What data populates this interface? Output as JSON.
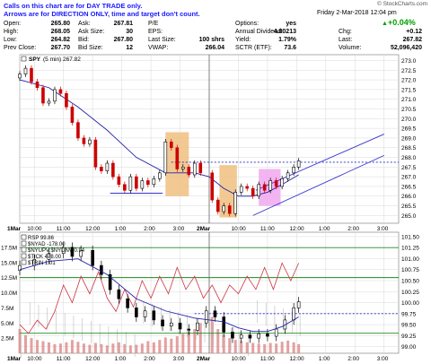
{
  "notes": {
    "line1": "Calls on this chart are for DAY TRADE only.",
    "line2": "Arrows are for DIRECTION ONLY, time and target don't count."
  },
  "header": {
    "date_time": "Friday  2-Mar-2018  12:04 pm",
    "brand": "© StockCharts.com",
    "change_pct": "+0.04%",
    "change_label": "Chg:",
    "change_value": "+0.12",
    "last_label": "Last:",
    "last_value": "267.82",
    "volume_label": "Volume:",
    "volume_value": "52,096,420"
  },
  "quote": {
    "open_label": "Open:",
    "open": "265.80",
    "high_label": "High:",
    "high": "268.05",
    "low_label": "Low:",
    "low": "264.82",
    "prev_label": "Prev Close:",
    "prev": "267.70",
    "ask_label": "Ask:",
    "ask": "267.81",
    "asksize_label": "Ask Size:",
    "asksize": "30",
    "bid_label": "Bid:",
    "bid": "267.80",
    "bidsize_label": "Bid Size:",
    "bidsize": "12",
    "pe_label": "P/E",
    "pe": "",
    "eps_label": "EPS:",
    "eps": "",
    "lastsize_label": "Last Size:",
    "lastsize": "100 shrs",
    "vwap_label": "VWAP:",
    "vwap": "266.04",
    "options_label": "Options:",
    "options": "yes",
    "div_label": "Annual Dividend:",
    "div": "4.80213",
    "yield_label": "Yield:",
    "yield": "1.79%",
    "sctr_label": "SCTR (ETF):",
    "sctr": "73.6"
  },
  "colors": {
    "up": "#000000",
    "down": "#cc0000",
    "ma": "#2222aa",
    "channel": "#3333cc",
    "dotted": "#2222cc",
    "grid": "#d8d8d8",
    "orange_box": "#f0c080",
    "pink_box": "#f0a8f0",
    "green_line": "#1c8c1c",
    "rsp_line": "#cc3344"
  },
  "chart_data": [
    {
      "type": "candlestick",
      "title": "SPY (5 min) 267.82",
      "legend_symbol": "SPY",
      "legend_text": "(5 min) 267.82",
      "y_ticks": [
        "273.0",
        "272.5",
        "272.0",
        "271.5",
        "271.0",
        "270.5",
        "270.0",
        "269.5",
        "269.0",
        "268.5",
        "268.0",
        "267.5",
        "267.0",
        "266.5",
        "266.0",
        "265.5",
        "265.0"
      ],
      "ylim": [
        264.6,
        273.3
      ],
      "x_ticks": [
        "1Mar",
        "10:00",
        "11:00",
        "12:00",
        "1:00",
        "2:00",
        "3:00",
        "2Mar",
        "10:00",
        "11:00",
        "12:00",
        "1:00",
        "2:00",
        "3:00"
      ],
      "x_tick_hours": [
        9.5,
        10,
        11,
        12,
        13,
        14,
        15,
        16,
        17,
        18,
        19,
        20,
        21,
        22
      ],
      "annotation_levels": {
        "dotted_resistance": 267.75,
        "support_line": 266.15
      },
      "channel_upper": [
        [
          17.6,
          266.3
        ],
        [
          22.0,
          269.2
        ]
      ],
      "channel_lower": [
        [
          17.5,
          265.0
        ],
        [
          22.0,
          268.1
        ]
      ],
      "orange_box_range": {
        "x": [
          14.5,
          15.3
        ],
        "y": [
          266.0,
          269.3
        ]
      },
      "pink_box_range": {
        "x": [
          17.7,
          18.45
        ],
        "y": [
          265.5,
          267.4
        ]
      },
      "close_series": [
        [
          9.5,
          272.3
        ],
        [
          9.7,
          272.6
        ],
        [
          9.9,
          271.9
        ],
        [
          10.1,
          271.6
        ],
        [
          10.3,
          270.8
        ],
        [
          10.5,
          270.9
        ],
        [
          10.7,
          271.5
        ],
        [
          10.9,
          271.3
        ],
        [
          11.1,
          270.6
        ],
        [
          11.3,
          269.8
        ],
        [
          11.5,
          269.0
        ],
        [
          11.7,
          268.7
        ],
        [
          11.9,
          268.9
        ],
        [
          12.1,
          267.5
        ],
        [
          12.3,
          267.3
        ],
        [
          12.5,
          267.7
        ],
        [
          12.7,
          267.0
        ],
        [
          12.9,
          266.6
        ],
        [
          13.1,
          266.3
        ],
        [
          13.3,
          267.0
        ],
        [
          13.5,
          266.4
        ],
        [
          13.7,
          266.8
        ],
        [
          13.9,
          266.6
        ],
        [
          14.1,
          266.9
        ],
        [
          14.3,
          267.2
        ],
        [
          14.5,
          268.8
        ],
        [
          14.7,
          268.5
        ],
        [
          14.9,
          267.4
        ],
        [
          15.1,
          267.5
        ],
        [
          15.3,
          267.1
        ],
        [
          15.5,
          267.7
        ],
        [
          15.7,
          267.2
        ],
        [
          16.1,
          265.8
        ],
        [
          16.3,
          265.2
        ],
        [
          16.5,
          265.5
        ],
        [
          16.7,
          265.1
        ],
        [
          16.9,
          266.2
        ],
        [
          17.1,
          266.5
        ],
        [
          17.3,
          266.4
        ],
        [
          17.5,
          266.0
        ],
        [
          17.7,
          266.6
        ],
        [
          17.9,
          266.3
        ],
        [
          18.1,
          266.8
        ],
        [
          18.3,
          266.5
        ],
        [
          18.5,
          266.9
        ],
        [
          18.7,
          267.2
        ],
        [
          18.9,
          267.5
        ],
        [
          19.07,
          267.82
        ]
      ],
      "ma_series": [
        [
          9.5,
          272.0
        ],
        [
          10.5,
          271.6
        ],
        [
          11.5,
          270.6
        ],
        [
          12.5,
          269.4
        ],
        [
          13.5,
          268.0
        ],
        [
          14.5,
          267.2
        ],
        [
          15.5,
          267.2
        ],
        [
          16.0,
          267.0
        ],
        [
          16.5,
          266.4
        ],
        [
          17.0,
          266.0
        ],
        [
          17.5,
          266.0
        ],
        [
          18.0,
          266.2
        ],
        [
          18.5,
          266.6
        ],
        [
          19.07,
          267.1
        ]
      ]
    },
    {
      "type": "line",
      "title": "RSP 99.86",
      "legend": [
        "RSP 99.86",
        "$NYAD -178.00",
        "$NYUPV:$NYDNV 0.94",
        "$TICK 478.00",
        "$TRIN 1.01"
      ],
      "y_left_ticks": [
        "17.5M",
        "15.0M",
        "12.5M",
        "10.0M",
        "7.5M",
        "5.0M",
        "2.5M"
      ],
      "y_left_lim": [
        0,
        20
      ],
      "y_right_ticks": [
        "101.50",
        "101.25",
        "101.00",
        "100.75",
        "100.50",
        "100.25",
        "100.00",
        "99.75",
        "99.50",
        "99.25",
        "99.00"
      ],
      "y_right_lim": [
        98.85,
        101.6
      ],
      "green_levels_left": [
        12.5,
        3.3
      ],
      "green_level_right": 101.25,
      "dotted_level_right": 99.75,
      "rsp_price": [
        [
          9.5,
          99.5
        ],
        [
          9.8,
          99.3
        ],
        [
          10.1,
          99.6
        ],
        [
          10.4,
          99.4
        ],
        [
          10.7,
          99.8
        ],
        [
          11.0,
          100.4
        ],
        [
          11.3,
          100.0
        ],
        [
          11.6,
          100.6
        ],
        [
          11.9,
          100.2
        ],
        [
          12.2,
          100.7
        ],
        [
          12.5,
          100.1
        ],
        [
          12.8,
          99.8
        ],
        [
          13.1,
          100.3
        ],
        [
          13.4,
          99.9
        ],
        [
          13.7,
          100.5
        ],
        [
          14.0,
          100.1
        ],
        [
          14.3,
          100.6
        ],
        [
          14.6,
          100.2
        ],
        [
          14.9,
          100.8
        ],
        [
          15.2,
          100.3
        ],
        [
          15.5,
          100.6
        ],
        [
          15.8,
          100.1
        ],
        [
          16.1,
          100.4
        ],
        [
          16.4,
          100.0
        ],
        [
          16.7,
          100.4
        ],
        [
          17.0,
          100.2
        ],
        [
          17.3,
          100.6
        ],
        [
          17.6,
          100.3
        ],
        [
          17.9,
          100.8
        ],
        [
          18.2,
          100.3
        ],
        [
          18.5,
          100.9
        ],
        [
          18.8,
          100.5
        ],
        [
          19.07,
          100.9
        ]
      ],
      "breadth_price": [
        [
          9.5,
          14.5
        ],
        [
          10.0,
          15.5
        ],
        [
          10.5,
          16.5
        ],
        [
          11.0,
          17.5
        ],
        [
          11.3,
          16.0
        ],
        [
          11.6,
          17.0
        ],
        [
          12.0,
          14.5
        ],
        [
          12.3,
          13.0
        ],
        [
          12.6,
          10.5
        ],
        [
          12.9,
          9.0
        ],
        [
          13.2,
          7.5
        ],
        [
          13.5,
          6.0
        ],
        [
          13.8,
          7.0
        ],
        [
          14.1,
          5.5
        ],
        [
          14.4,
          4.5
        ],
        [
          14.7,
          5.0
        ],
        [
          15.0,
          4.0
        ],
        [
          15.3,
          3.8
        ],
        [
          15.6,
          5.0
        ],
        [
          15.9,
          7.0
        ],
        [
          16.2,
          6.0
        ],
        [
          16.5,
          3.5
        ],
        [
          16.8,
          2.5
        ],
        [
          17.1,
          3.0
        ],
        [
          17.4,
          2.5
        ],
        [
          17.7,
          3.2
        ],
        [
          18.0,
          2.8
        ],
        [
          18.3,
          4.0
        ],
        [
          18.6,
          5.5
        ],
        [
          18.9,
          7.5
        ],
        [
          19.07,
          8.5
        ]
      ],
      "breadth_ma": [
        [
          9.5,
          13.8
        ],
        [
          10.5,
          15.2
        ],
        [
          11.5,
          15.6
        ],
        [
          12.5,
          13.0
        ],
        [
          13.5,
          9.0
        ],
        [
          14.5,
          7.0
        ],
        [
          15.5,
          5.8
        ],
        [
          16.5,
          5.2
        ],
        [
          17.0,
          4.2
        ],
        [
          17.5,
          3.6
        ],
        [
          18.0,
          3.6
        ],
        [
          18.5,
          4.4
        ],
        [
          19.07,
          6.0
        ]
      ],
      "volume": [
        [
          9.5,
          4
        ],
        [
          9.7,
          3
        ],
        [
          9.9,
          2.5
        ],
        [
          10.1,
          2.2
        ],
        [
          10.3,
          2
        ],
        [
          10.5,
          1.8
        ],
        [
          10.7,
          1.5
        ],
        [
          10.9,
          1.6
        ],
        [
          11.1,
          1.8
        ],
        [
          11.3,
          2.2
        ],
        [
          11.5,
          1.9
        ],
        [
          11.7,
          1.6
        ],
        [
          11.9,
          1.4
        ],
        [
          12.1,
          1.7
        ],
        [
          12.3,
          1.5
        ],
        [
          12.5,
          1.3
        ],
        [
          12.7,
          1.6
        ],
        [
          12.9,
          1.8
        ],
        [
          13.1,
          1.5
        ],
        [
          13.3,
          1.3
        ],
        [
          13.5,
          1.4
        ],
        [
          13.7,
          1.6
        ],
        [
          13.9,
          2
        ],
        [
          14.1,
          1.8
        ],
        [
          14.3,
          2.2
        ],
        [
          14.5,
          2.6
        ],
        [
          14.7,
          2.4
        ],
        [
          14.9,
          2.8
        ],
        [
          15.1,
          3.2
        ],
        [
          15.3,
          3.6
        ],
        [
          15.5,
          4
        ],
        [
          15.7,
          5
        ],
        [
          16.1,
          6
        ],
        [
          16.3,
          4
        ],
        [
          16.5,
          3
        ],
        [
          16.7,
          2.5
        ],
        [
          16.9,
          2.2
        ],
        [
          17.1,
          2
        ],
        [
          17.3,
          1.8
        ],
        [
          17.5,
          1.7
        ],
        [
          17.7,
          1.6
        ],
        [
          17.9,
          1.5
        ],
        [
          18.1,
          1.7
        ],
        [
          18.3,
          1.6
        ],
        [
          18.5,
          1.9
        ],
        [
          18.7,
          2.1
        ],
        [
          18.9,
          1.8
        ],
        [
          19.07,
          1.5
        ]
      ],
      "x_ticks": [
        "1Mar",
        "10:00",
        "11:00",
        "12:00",
        "1:00",
        "2:00",
        "3:00",
        "2Mar",
        "10:00",
        "11:00",
        "12:00",
        "1:00",
        "2:00",
        "3:00"
      ]
    }
  ]
}
